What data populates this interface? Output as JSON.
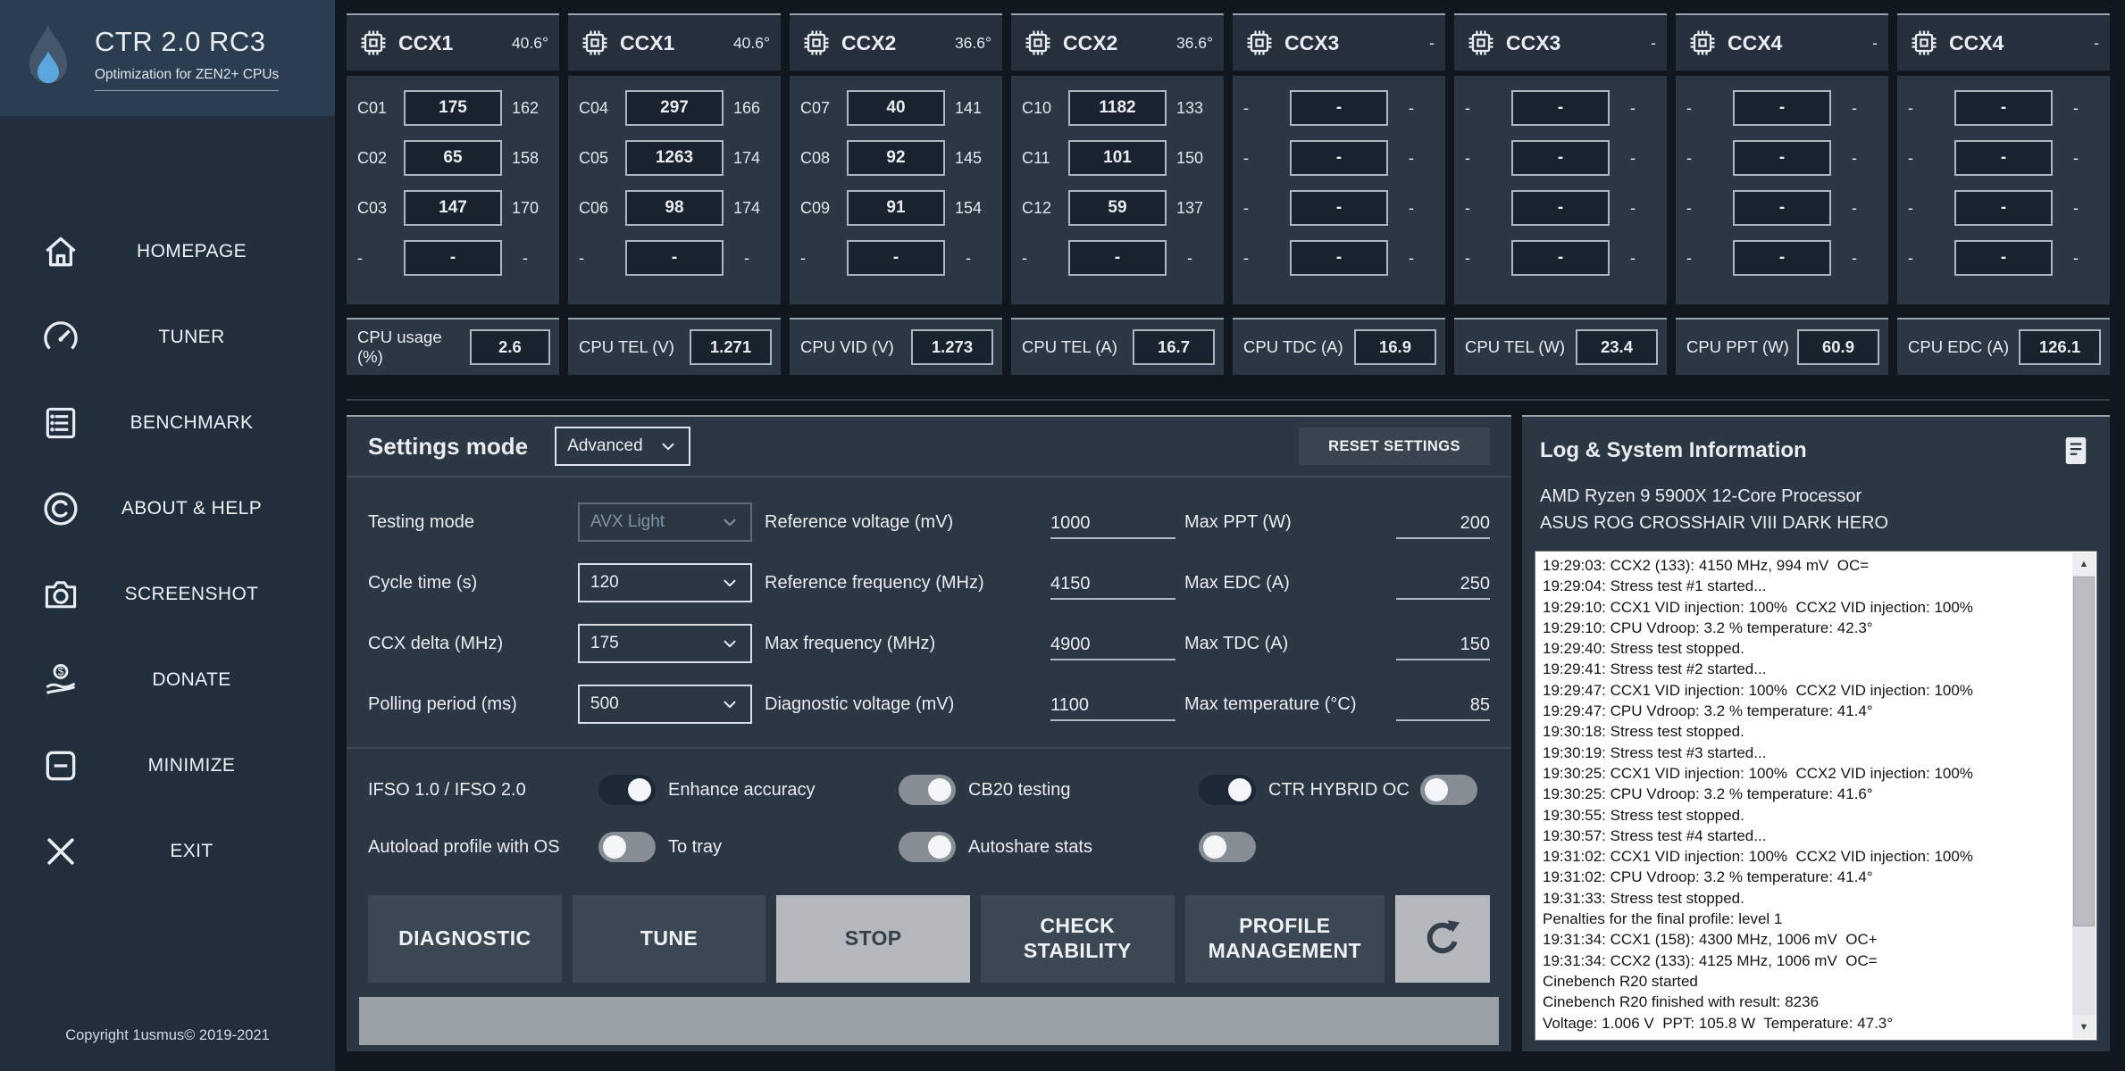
{
  "app": {
    "title": "CTR 2.0 RC3",
    "subtitle": "Optimization for ZEN2+ CPUs",
    "copyright": "Copyright 1usmus© 2019-2021",
    "logo_icon": "flame-logo-icon"
  },
  "sidebar": {
    "items": [
      {
        "icon": "home-icon",
        "label": "HOMEPAGE"
      },
      {
        "icon": "gauge-icon",
        "label": "TUNER"
      },
      {
        "icon": "list-icon",
        "label": "BENCHMARK"
      },
      {
        "icon": "copyright-icon",
        "label": "ABOUT & HELP"
      },
      {
        "icon": "camera-icon",
        "label": "SCREENSHOT"
      },
      {
        "icon": "donate-icon",
        "label": "DONATE"
      },
      {
        "icon": "minimize-icon",
        "label": "MINIMIZE"
      },
      {
        "icon": "exit-icon",
        "label": "EXIT"
      }
    ]
  },
  "ccx_header_icon": "chip-icon",
  "ccx_panels": [
    {
      "name": "CCX1",
      "temp": "40.6°",
      "rows": [
        {
          "core": "C01",
          "value": "175",
          "extra": "162"
        },
        {
          "core": "C02",
          "value": "65",
          "extra": "158"
        },
        {
          "core": "C03",
          "value": "147",
          "extra": "170"
        },
        {
          "core": "-",
          "value": "-",
          "extra": "-"
        }
      ]
    },
    {
      "name": "CCX1",
      "temp": "40.6°",
      "rows": [
        {
          "core": "C04",
          "value": "297",
          "extra": "166"
        },
        {
          "core": "C05",
          "value": "1263",
          "extra": "174"
        },
        {
          "core": "C06",
          "value": "98",
          "extra": "174"
        },
        {
          "core": "-",
          "value": "-",
          "extra": "-"
        }
      ]
    },
    {
      "name": "CCX2",
      "temp": "36.6°",
      "rows": [
        {
          "core": "C07",
          "value": "40",
          "extra": "141"
        },
        {
          "core": "C08",
          "value": "92",
          "extra": "145"
        },
        {
          "core": "C09",
          "value": "91",
          "extra": "154"
        },
        {
          "core": "-",
          "value": "-",
          "extra": "-"
        }
      ]
    },
    {
      "name": "CCX2",
      "temp": "36.6°",
      "rows": [
        {
          "core": "C10",
          "value": "1182",
          "extra": "133"
        },
        {
          "core": "C11",
          "value": "101",
          "extra": "150"
        },
        {
          "core": "C12",
          "value": "59",
          "extra": "137"
        },
        {
          "core": "-",
          "value": "-",
          "extra": "-"
        }
      ]
    },
    {
      "name": "CCX3",
      "temp": "-",
      "rows": [
        {
          "core": "-",
          "value": "-",
          "extra": "-"
        },
        {
          "core": "-",
          "value": "-",
          "extra": "-"
        },
        {
          "core": "-",
          "value": "-",
          "extra": "-"
        },
        {
          "core": "-",
          "value": "-",
          "extra": "-"
        }
      ]
    },
    {
      "name": "CCX3",
      "temp": "-",
      "rows": [
        {
          "core": "-",
          "value": "-",
          "extra": "-"
        },
        {
          "core": "-",
          "value": "-",
          "extra": "-"
        },
        {
          "core": "-",
          "value": "-",
          "extra": "-"
        },
        {
          "core": "-",
          "value": "-",
          "extra": "-"
        }
      ]
    },
    {
      "name": "CCX4",
      "temp": "-",
      "rows": [
        {
          "core": "-",
          "value": "-",
          "extra": "-"
        },
        {
          "core": "-",
          "value": "-",
          "extra": "-"
        },
        {
          "core": "-",
          "value": "-",
          "extra": "-"
        },
        {
          "core": "-",
          "value": "-",
          "extra": "-"
        }
      ]
    },
    {
      "name": "CCX4",
      "temp": "-",
      "rows": [
        {
          "core": "-",
          "value": "-",
          "extra": "-"
        },
        {
          "core": "-",
          "value": "-",
          "extra": "-"
        },
        {
          "core": "-",
          "value": "-",
          "extra": "-"
        },
        {
          "core": "-",
          "value": "-",
          "extra": "-"
        }
      ]
    }
  ],
  "stats": [
    {
      "label": "CPU usage (%)",
      "value": "2.6"
    },
    {
      "label": "CPU TEL (V)",
      "value": "1.271"
    },
    {
      "label": "CPU VID (V)",
      "value": "1.273"
    },
    {
      "label": "CPU TEL (A)",
      "value": "16.7"
    },
    {
      "label": "CPU TDC (A)",
      "value": "16.9"
    },
    {
      "label": "CPU TEL (W)",
      "value": "23.4"
    },
    {
      "label": "CPU PPT (W)",
      "value": "60.9"
    },
    {
      "label": "CPU EDC (A)",
      "value": "126.1"
    }
  ],
  "settings": {
    "mode_label": "Settings mode",
    "mode_value": "Advanced",
    "dropdown_chevron_icon": "chevron-down-icon",
    "reset_label": "RESET SETTINGS",
    "form_rows": [
      {
        "dd_label": "Testing mode",
        "dd_value": "AVX Light",
        "dd_disabled": true,
        "mid_label": "Reference voltage (mV)",
        "mid_value": "1000",
        "right_label": "Max PPT (W)",
        "right_value": "200"
      },
      {
        "dd_label": "Cycle time (s)",
        "dd_value": "120",
        "dd_disabled": false,
        "mid_label": "Reference frequency (MHz)",
        "mid_value": "4150",
        "right_label": "Max EDC (A)",
        "right_value": "250"
      },
      {
        "dd_label": "CCX delta (MHz)",
        "dd_value": "175",
        "dd_disabled": false,
        "mid_label": "Max frequency (MHz)",
        "mid_value": "4900",
        "right_label": "Max TDC (A)",
        "right_value": "150"
      },
      {
        "dd_label": "Polling period (ms)",
        "dd_value": "500",
        "dd_disabled": false,
        "mid_label": "Diagnostic voltage (mV)",
        "mid_value": "1100",
        "right_label": "Max temperature (°C)",
        "right_value": "85"
      }
    ],
    "toggle_rows": [
      [
        {
          "label": "IFSO 1.0 / IFSO 2.0",
          "on": true,
          "knob": "right"
        },
        {
          "label": "Enhance accuracy",
          "on": false,
          "knob": "right"
        },
        {
          "label": "CB20 testing",
          "on": true,
          "knob": "right"
        },
        {
          "label": "CTR HYBRID OC",
          "on": false,
          "knob": "left"
        }
      ],
      [
        {
          "label": "Autoload profile with OS",
          "on": false,
          "knob": "left"
        },
        {
          "label": "To tray",
          "on": false,
          "knob": "right"
        },
        {
          "label": "Autoshare stats",
          "on": false,
          "knob": "left"
        }
      ]
    ],
    "buttons": [
      {
        "label": "DIAGNOSTIC",
        "style": "dark"
      },
      {
        "label": "TUNE",
        "style": "dark"
      },
      {
        "label": "STOP",
        "style": "light"
      },
      {
        "label": "CHECK STABILITY",
        "style": "dark"
      },
      {
        "label": "PROFILE MANAGEMENT",
        "style": "dark"
      },
      {
        "label": "",
        "icon": "refresh-icon",
        "style": "light"
      }
    ]
  },
  "log": {
    "title": "Log & System Information",
    "header_icon": "report-icon",
    "system_info": [
      "AMD Ryzen 9 5900X 12-Core Processor",
      "ASUS ROG CROSSHAIR VIII DARK HERO"
    ],
    "scrollbar": {
      "up": "▲",
      "down": "▼"
    },
    "lines": [
      "19:29:03: CCX2 (133): 4150 MHz, 994 mV  OC=",
      "19:29:04: Stress test #1 started...",
      "19:29:10: CCX1 VID injection: 100%  CCX2 VID injection: 100%",
      "19:29:10: CPU Vdroop: 3.2 % temperature: 42.3°",
      "19:29:40: Stress test stopped.",
      "19:29:41: Stress test #2 started...",
      "19:29:47: CCX1 VID injection: 100%  CCX2 VID injection: 100%",
      "19:29:47: CPU Vdroop: 3.2 % temperature: 41.4°",
      "19:30:18: Stress test stopped.",
      "19:30:19: Stress test #3 started...",
      "19:30:25: CCX1 VID injection: 100%  CCX2 VID injection: 100%",
      "19:30:25: CPU Vdroop: 3.2 % temperature: 41.6°",
      "19:30:55: Stress test stopped.",
      "19:30:57: Stress test #4 started...",
      "19:31:02: CCX1 VID injection: 100%  CCX2 VID injection: 100%",
      "19:31:02: CPU Vdroop: 3.2 % temperature: 41.4°",
      "19:31:33: Stress test stopped.",
      "Penalties for the final profile: level 1",
      "19:31:34: CCX1 (158): 4300 MHz, 1006 mV  OC+",
      "19:31:34: CCX2 (133): 4125 MHz, 1006 mV  OC=",
      "Cinebench R20 started",
      "Cinebench R20 finished with result: 8236",
      "Voltage: 1.006 V  PPT: 105.8 W  Temperature: 47.3°"
    ]
  }
}
